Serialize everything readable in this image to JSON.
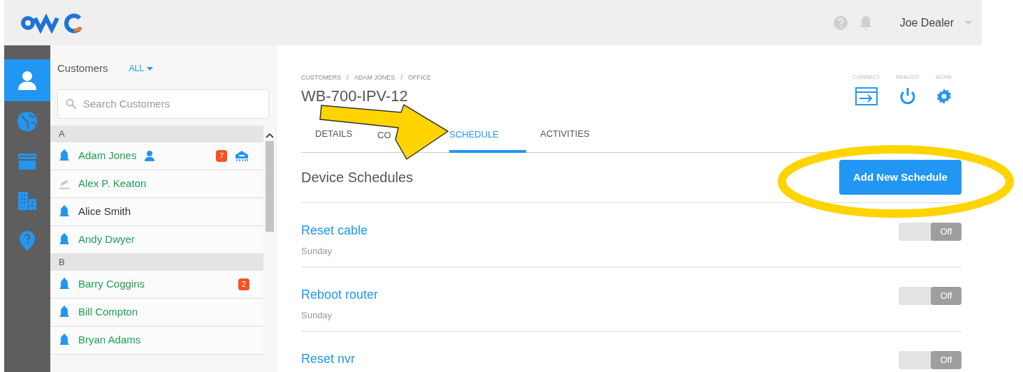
{
  "header": {
    "user": "Joe Dealer"
  },
  "rail": [
    {
      "kind": "person",
      "selected": true
    },
    {
      "kind": "globe",
      "selected": false
    },
    {
      "kind": "store",
      "selected": false
    },
    {
      "kind": "building",
      "selected": false
    },
    {
      "kind": "help",
      "selected": false
    }
  ],
  "customers": {
    "title": "Customers",
    "filter": "ALL",
    "search": {
      "placeholder": "Search Customers"
    },
    "groups": [
      {
        "letter": "A",
        "items": [
          {
            "name": "Adam Jones",
            "color": "#1e9e5a",
            "alerts": true,
            "badge": "7",
            "user_icon": true,
            "device_icon": true
          },
          {
            "name": "Alex P. Keaton",
            "color": "#1e9e5a",
            "alerts": false,
            "user_icon": false,
            "device_icon": false
          },
          {
            "name": "Alice Smith",
            "color": "#333333",
            "alerts": true,
            "user_icon": false,
            "device_icon": false
          },
          {
            "name": "Andy Dwyer",
            "color": "#1e9e5a",
            "alerts": true,
            "user_icon": false,
            "device_icon": false
          }
        ]
      },
      {
        "letter": "B",
        "items": [
          {
            "name": "Barry Coggins",
            "color": "#1e9e5a",
            "alerts": true,
            "badge": "2",
            "user_icon": false,
            "device_icon": false
          },
          {
            "name": "Bill Compton",
            "color": "#1e9e5a",
            "alerts": true,
            "user_icon": false,
            "device_icon": false
          },
          {
            "name": "Bryan Adams",
            "color": "#1e9e5a",
            "alerts": true,
            "user_icon": false,
            "device_icon": false
          }
        ]
      }
    ]
  },
  "device": {
    "breadcrumb": [
      "CUSTOMERS",
      "ADAM JONES",
      "OFFICE"
    ],
    "breadcrumb_separators": [
      "/",
      "/"
    ],
    "title": "WB-700-IPV-12",
    "actions": [
      {
        "kind": "connect",
        "label": "CONNECT"
      },
      {
        "kind": "reboot",
        "label": "REBOOT"
      },
      {
        "kind": "more",
        "label": "MORE"
      }
    ],
    "tabs": [
      {
        "label": "DETAILS",
        "selected": false
      },
      {
        "label": "CO",
        "selected": false
      },
      {
        "label": "SCHEDULE",
        "selected": true
      },
      {
        "label": "ACTIVITIES",
        "selected": false
      }
    ]
  },
  "schedules": {
    "title": "Device Schedules",
    "add_button": "Add New Schedule",
    "items": [
      {
        "name": "Reset cable",
        "when": "Sunday",
        "on": false,
        "toggle_label": "Off"
      },
      {
        "name": "Reboot router",
        "when": "Sunday",
        "on": false,
        "toggle_label": "Off"
      },
      {
        "name": "Reset nvr",
        "on": false,
        "toggle_label": "Off"
      }
    ]
  }
}
